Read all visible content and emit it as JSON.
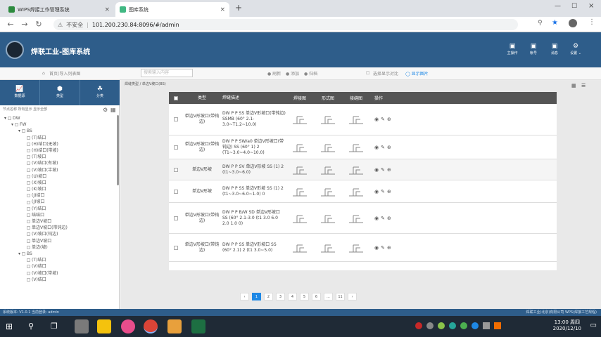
{
  "browser": {
    "tabs": [
      {
        "title": "WIPS焊接工作管理系统",
        "active": false
      },
      {
        "title": "图库系统",
        "active": true
      }
    ],
    "url": "101.200.230.84:8096/#/admin",
    "insecure_label": "不安全"
  },
  "app": {
    "title": "焊联工业-图库系统",
    "header_buttons": [
      {
        "label": "主操作",
        "icon": "▣"
      },
      {
        "label": "帐号",
        "icon": "▣"
      },
      {
        "label": "消息",
        "icon": "▣"
      },
      {
        "label": "设置 ⌄",
        "icon": "⚙"
      }
    ]
  },
  "toolbar": {
    "home": "首页(导入列表图",
    "search_placeholder": "搜索输入内容",
    "filters": [
      "● 刷新",
      "● 添加",
      "● 归档"
    ],
    "compare": "选择显示对比",
    "scale": "◯ 显示图片"
  },
  "sidebar": {
    "tabs": [
      {
        "label": "数据源",
        "icon": "📈"
      },
      {
        "label": "类型",
        "icon": "⬢"
      },
      {
        "label": "分类",
        "icon": "☘"
      }
    ],
    "filter_text": "节点名称  所有显示  显示全部",
    "tree": [
      {
        "label": "DW",
        "d": 0
      },
      {
        "label": "FW",
        "d": 1
      },
      {
        "label": "BS",
        "d": 2
      },
      {
        "label": "(T)结口",
        "d": 3
      },
      {
        "label": "(H)结口(无坡)",
        "d": 3
      },
      {
        "label": "(H)结口(带坡)",
        "d": 3
      },
      {
        "label": "(T)坡口",
        "d": 3
      },
      {
        "label": "(V)结口(有坡)",
        "d": 3
      },
      {
        "label": "(V)坡口(半坡)",
        "d": 3
      },
      {
        "label": "(U)坡口",
        "d": 3
      },
      {
        "label": "(X)坡口",
        "d": 3
      },
      {
        "label": "(K)坡口",
        "d": 3
      },
      {
        "label": "(J)结口",
        "d": 3
      },
      {
        "label": "(J)坡口",
        "d": 3
      },
      {
        "label": "(Y)结口",
        "d": 3
      },
      {
        "label": "结结口",
        "d": 3
      },
      {
        "label": "单边V坡口",
        "d": 3
      },
      {
        "label": "单边V坡口(带钝边)",
        "d": 3
      },
      {
        "label": "(V)坡口(钝边)",
        "d": 3
      },
      {
        "label": "单边V坡口",
        "d": 3
      },
      {
        "label": "单边(坡)",
        "d": 3
      },
      {
        "label": "BS",
        "d": 2
      },
      {
        "label": "(T)结口",
        "d": 3
      },
      {
        "label": "(V)结口",
        "d": 3
      },
      {
        "label": "(V)坡口(带坡)",
        "d": 3
      },
      {
        "label": "(V)结口",
        "d": 3
      }
    ]
  },
  "main": {
    "breadcrumb": "焊缝类型 / 单边V坡口(BS)",
    "columns": [
      "类型",
      "焊缝描述",
      "焊接图",
      "形式图",
      "接缝图",
      "操作"
    ],
    "rows": [
      {
        "type": "单边V形坡口(带钝边)",
        "desc": "DW P P SS 单边V形坡口(带钝边) SSMB (60° 2.1-3.0~T1.2~10.0)"
      },
      {
        "type": "单边V形坡口(带钝边)",
        "desc": "DW P P SW/a0 单边V形坡口(带钝边) SS (60° 1) 2 (T1~3.0~4.0~10.0)"
      },
      {
        "type": "单边V形坡",
        "desc": "DW P P SV 单边V形坡 SS (1) 2 (t1~3.0~6.0)"
      },
      {
        "type": "单边V形坡",
        "desc": "DW P P SS 单边V形坡 SS (1) 2 (t1~3.0~6.0~1.0) 0"
      },
      {
        "type": "单边V形坡口(带钝边)",
        "desc": "DW P P B/W SD 单边V形坡口 SS (60° 2.1-3.0 (t1 3.0 6.0 2.0 1.0 0)"
      },
      {
        "type": "单边V形坡口(带钝边)",
        "desc": "DW P P SS 单边V形坡口 SS (60° 2.1) 2 (t1 3.0~5.0)"
      }
    ],
    "pages": [
      "‹",
      "1",
      "2",
      "3",
      "4",
      "5",
      "6",
      "...",
      "11",
      "›"
    ],
    "current_page": "1"
  },
  "statusbar": {
    "left": "系统版本: V1.0.1  当前登录: admin",
    "right": "焊联工业(北京)有限公司  WPS(焊接工艺规程)"
  },
  "taskbar": {
    "time": "13:00 周四",
    "date": "2020/12/10"
  }
}
